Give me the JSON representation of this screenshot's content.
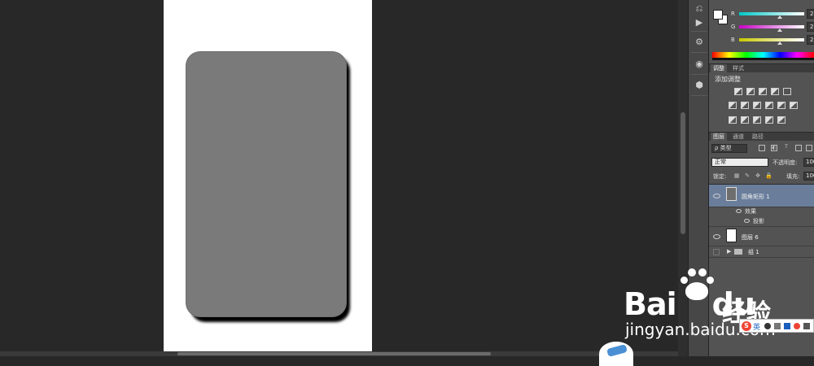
{
  "color_panel": {
    "channels": [
      {
        "label": "R",
        "value": "255",
        "gradient": [
          "#00c8c8",
          "#ffffff"
        ]
      },
      {
        "label": "G",
        "value": "255",
        "gradient": [
          "#c800c8",
          "#ffffff"
        ]
      },
      {
        "label": "B",
        "value": "255",
        "gradient": [
          "#c8c800",
          "#ffffff"
        ]
      }
    ],
    "foreground": "#ffffff",
    "background": "#ffffff"
  },
  "adjust_panel": {
    "tabs": [
      "调整",
      "样式"
    ],
    "title": "添加调整"
  },
  "layers_panel": {
    "tabs": [
      "图层",
      "通道",
      "路径"
    ],
    "filter_label": "ρ 类型",
    "blend_mode": "正常",
    "opacity_label": "不透明度:",
    "opacity_value": "100",
    "lock_label": "锁定:",
    "fill_label": "填充:",
    "fill_value": "100",
    "layers": [
      {
        "name": "圆角矩形 1",
        "selected": true,
        "effects_label": "效果",
        "effect": "投影"
      },
      {
        "name": "图层 6",
        "selected": false
      },
      {
        "name": "组 1",
        "selected": false
      }
    ]
  },
  "watermark": {
    "logo": "Bai",
    "logo_du": "du",
    "cn": "经验",
    "url": "jingyan.baidu.com"
  },
  "ime": {
    "logo": "S",
    "lang": "英"
  }
}
